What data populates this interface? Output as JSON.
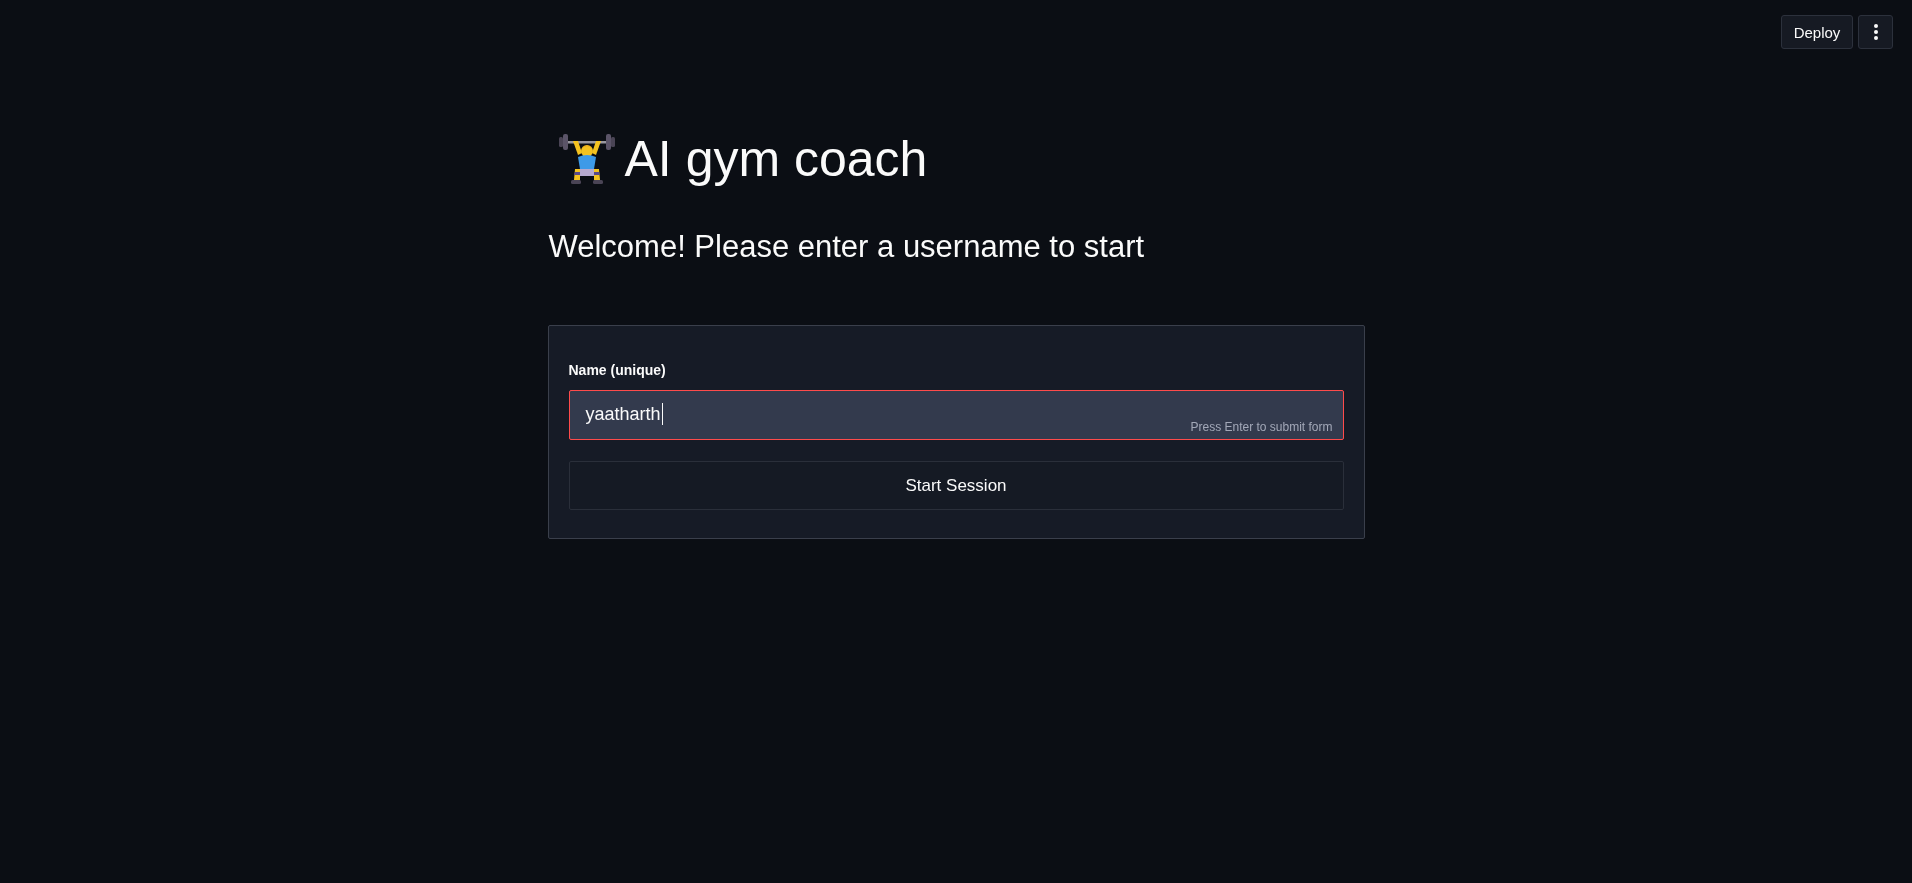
{
  "toolbar": {
    "deploy_button": "Deploy"
  },
  "title": "AI gym coach",
  "subtitle": "Welcome! Please enter a username to start",
  "form": {
    "field": {
      "label": "Name (unique)",
      "value": "yaatharth",
      "focused": true,
      "hint": "Press Enter to submit form"
    },
    "submit_button": "Start Session"
  }
}
